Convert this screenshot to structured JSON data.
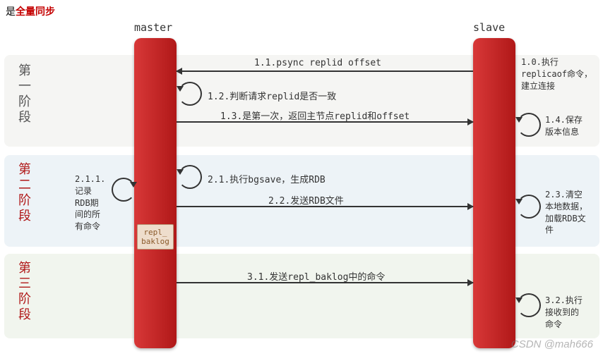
{
  "title_prefix": "是",
  "title_highlight": "全量同步",
  "actors": {
    "master": "master",
    "slave": "slave"
  },
  "phases": {
    "p1": "第一阶段",
    "p2": "第二阶段",
    "p3": "第三阶段"
  },
  "messages": {
    "m11": "1.1.psync replid offset",
    "m12": "1.2.判断请求replid是否一致",
    "m13": "1.3.是第一次，返回主节点replid和offset",
    "m21": "2.1.执行bgsave，生成RDB",
    "m22": "2.2.发送RDB文件",
    "m31": "3.1.发送repl_baklog中的命令"
  },
  "notes": {
    "n10": "1.0.执行\nreplicaof命令，\n建立连接",
    "n14": "1.4.保存\n版本信息",
    "n211": "2.1.1.\n记录\nRDB期\n间的所\n有命令",
    "n23": "2.3.清空\n本地数据，\n加载RDB文\n件",
    "n32": "3.2.执行\n接收到的\n命令"
  },
  "baklog": "repl_\nbaklog",
  "watermark": "CSDN @mah666"
}
